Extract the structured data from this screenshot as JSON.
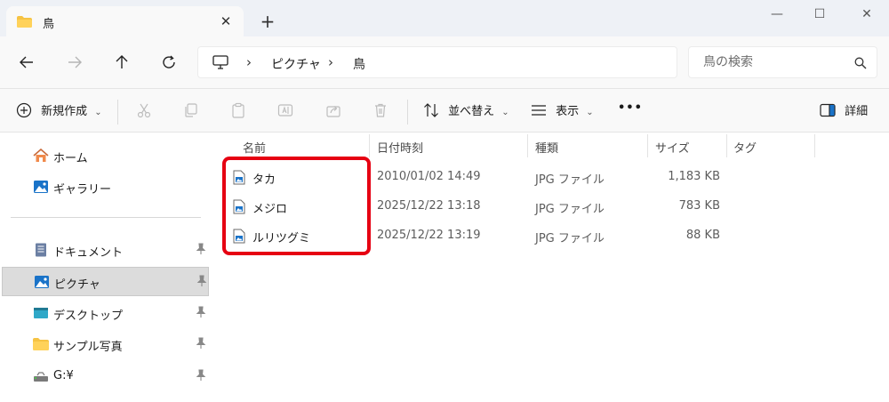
{
  "window": {
    "tab_title": "鳥",
    "close_tab": "✕",
    "new_tab": "+",
    "minimize": "—",
    "maximize": "☐",
    "close": "✕"
  },
  "address": {
    "crumbs": [
      "ピクチャ",
      "鳥"
    ],
    "separator": "›",
    "search_placeholder": "鳥の検索"
  },
  "toolbar": {
    "new_label": "新規作成",
    "sort_label": "並べ替え",
    "view_label": "表示",
    "more_label": "•••",
    "details_label": "詳細"
  },
  "sidebar": {
    "items": [
      {
        "label": "ホーム",
        "icon": "home-icon"
      },
      {
        "label": "ギャラリー",
        "icon": "gallery-icon"
      },
      {
        "label": "ドキュメント",
        "icon": "documents-icon",
        "pinned": true
      },
      {
        "label": "ピクチャ",
        "icon": "pictures-icon",
        "pinned": true,
        "selected": true
      },
      {
        "label": "デスクトップ",
        "icon": "desktop-icon",
        "pinned": true
      },
      {
        "label": "サンプル写真",
        "icon": "folder-icon",
        "pinned": true
      },
      {
        "label": "G:¥",
        "icon": "drive-icon",
        "pinned": true
      }
    ]
  },
  "columns": {
    "name": "名前",
    "date": "日付時刻",
    "type": "種類",
    "size": "サイズ",
    "tag": "タグ"
  },
  "files": [
    {
      "name": "タカ",
      "date": "2010/01/02 14:49",
      "type": "JPG ファイル",
      "size": "1,183 KB"
    },
    {
      "name": "メジロ",
      "date": "2025/12/22 13:18",
      "type": "JPG ファイル",
      "size": "783 KB"
    },
    {
      "name": "ルリツグミ",
      "date": "2025/12/22 13:19",
      "type": "JPG ファイル",
      "size": "88 KB"
    }
  ],
  "colors": {
    "highlight": "#e60012",
    "folder": "#f6c343",
    "accent": "#1a73c8"
  }
}
